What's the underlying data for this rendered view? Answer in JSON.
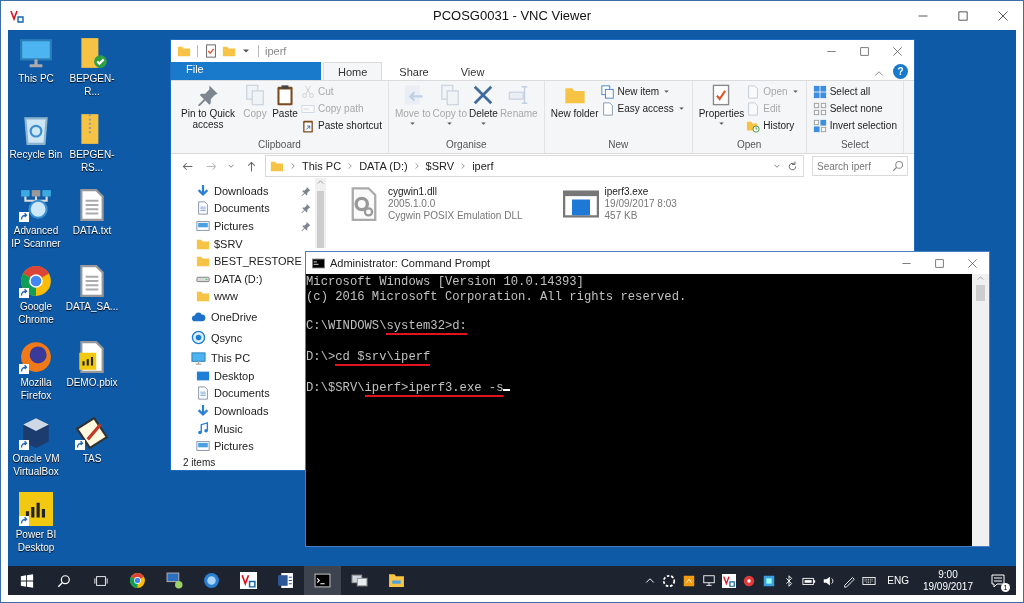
{
  "vnc_window": {
    "title": "PCOSG0031 - VNC Viewer"
  },
  "desktop_icons": [
    {
      "label": "This PC",
      "shortcut": false
    },
    {
      "label": "Recycle Bin",
      "shortcut": false
    },
    {
      "label": "Advanced IP Scanner",
      "shortcut": true
    },
    {
      "label": "Google Chrome",
      "shortcut": true
    },
    {
      "label": "Mozilla Firefox",
      "shortcut": true
    },
    {
      "label": "Oracle VM VirtualBox",
      "shortcut": true
    },
    {
      "label": "Power BI Desktop",
      "shortcut": true
    },
    {
      "label": "BEPGEN-R...",
      "shortcut": false
    },
    {
      "label": "BEPGEN-RS...",
      "shortcut": false
    },
    {
      "label": "DATA.txt",
      "shortcut": false
    },
    {
      "label": "DATA_SA...",
      "shortcut": false
    },
    {
      "label": "DEMO.pbix",
      "shortcut": false
    },
    {
      "label": "TAS",
      "shortcut": true
    }
  ],
  "explorer": {
    "title": "iperf",
    "tabs": [
      {
        "label": "File",
        "kind": "file",
        "selected": false
      },
      {
        "label": "Home",
        "kind": "tab",
        "selected": true
      },
      {
        "label": "Share",
        "kind": "tab",
        "selected": false
      },
      {
        "label": "View",
        "kind": "tab",
        "selected": false
      }
    ],
    "help": "?",
    "ribbon": {
      "groups": [
        {
          "label": "Clipboard",
          "large": [
            {
              "label": "Pin to Quick access",
              "disabled": false,
              "dropdown": false
            },
            {
              "label": "Copy",
              "disabled": true,
              "dropdown": false
            },
            {
              "label": "Paste",
              "disabled": false,
              "dropdown": false
            }
          ],
          "small": [
            {
              "label": "Cut",
              "disabled": true,
              "dropdown": false
            },
            {
              "label": "Copy path",
              "disabled": true,
              "dropdown": false
            },
            {
              "label": "Paste shortcut",
              "disabled": false,
              "dropdown": false
            }
          ]
        },
        {
          "label": "Organise",
          "large": [
            {
              "label": "Move to",
              "disabled": true,
              "dropdown": true
            },
            {
              "label": "Copy to",
              "disabled": true,
              "dropdown": true
            },
            {
              "label": "Delete",
              "disabled": false,
              "dropdown": true
            },
            {
              "label": "Rename",
              "disabled": true,
              "dropdown": false
            }
          ]
        },
        {
          "label": "New",
          "large": [
            {
              "label": "New folder",
              "disabled": false,
              "dropdown": false
            }
          ],
          "small": [
            {
              "label": "New item",
              "disabled": false,
              "dropdown": true
            },
            {
              "label": "Easy access",
              "disabled": false,
              "dropdown": true
            }
          ]
        },
        {
          "label": "Open",
          "large": [
            {
              "label": "Properties",
              "disabled": false,
              "dropdown": true
            }
          ],
          "small": [
            {
              "label": "Open",
              "disabled": true,
              "dropdown": true
            },
            {
              "label": "Edit",
              "disabled": true,
              "dropdown": false
            },
            {
              "label": "History",
              "disabled": false,
              "dropdown": false
            }
          ]
        },
        {
          "label": "Select",
          "small": [
            {
              "label": "Select all",
              "disabled": false,
              "dropdown": false
            },
            {
              "label": "Select none",
              "disabled": false,
              "dropdown": false
            },
            {
              "label": "Invert selection",
              "disabled": false,
              "dropdown": false
            }
          ]
        }
      ]
    },
    "address": {
      "crumbs": [
        "This PC",
        "DATA (D:)",
        "$SRV",
        "iperf"
      ]
    },
    "search": {
      "placeholder": "Search iperf"
    },
    "nav_pane": {
      "quick_access": [
        {
          "label": "Downloads",
          "pinned": true
        },
        {
          "label": "Documents",
          "pinned": true
        },
        {
          "label": "Pictures",
          "pinned": true
        },
        {
          "label": "$SRV",
          "pinned": false
        },
        {
          "label": "BEST_RESTORE",
          "pinned": false
        },
        {
          "label": "DATA (D:)",
          "pinned": false
        },
        {
          "label": "www",
          "pinned": false
        }
      ],
      "locations": [
        {
          "label": "OneDrive"
        },
        {
          "label": "Qsync"
        },
        {
          "label": "This PC",
          "children": [
            {
              "label": "Desktop"
            },
            {
              "label": "Documents"
            },
            {
              "label": "Downloads"
            },
            {
              "label": "Music"
            },
            {
              "label": "Pictures"
            }
          ]
        }
      ]
    },
    "files": [
      {
        "name": "cygwin1.dll",
        "details": [
          "2005.1.0.0",
          "Cygwin POSIX Emulation DLL"
        ]
      },
      {
        "name": "iperf3.exe",
        "details": [
          "19/09/2017 8:03",
          "457 KB"
        ]
      }
    ],
    "status_bar": {
      "item_count": "2 items"
    }
  },
  "command_prompt": {
    "title": "Administrator: Command Prompt",
    "lines": [
      {
        "kind": "output",
        "segments": [
          {
            "text": "Microsoft Windows [Version 10.0.14393]",
            "underlined": false
          }
        ]
      },
      {
        "kind": "output",
        "segments": [
          {
            "text": "(c) 2016 Microsoft Corporation. All rights reserved.",
            "underlined": false
          }
        ]
      },
      {
        "kind": "prompt",
        "segments": [
          {
            "text": "C:\\WINDOWS\\",
            "underlined": false
          },
          {
            "text": "system32>d:",
            "underlined": true
          }
        ]
      },
      {
        "kind": "prompt",
        "segments": [
          {
            "text": "D:\\>",
            "underlined": false
          },
          {
            "text": "cd $srv\\iperf",
            "underlined": true
          }
        ]
      },
      {
        "kind": "prompt",
        "segments": [
          {
            "text": "D:\\$SRV\\",
            "underlined": false
          },
          {
            "text": "iperf>iperf3.exe -s",
            "underlined": true
          }
        ]
      }
    ]
  },
  "taskbar": {
    "apps": [
      {
        "selected": false
      },
      {
        "selected": false
      },
      {
        "selected": false
      },
      {
        "selected": false
      },
      {
        "selected": false
      },
      {
        "selected": true
      },
      {
        "selected": false
      },
      {
        "selected": false
      }
    ],
    "language": "ENG",
    "time": "9:00",
    "date": "19/09/2017",
    "notifications": "1"
  }
}
